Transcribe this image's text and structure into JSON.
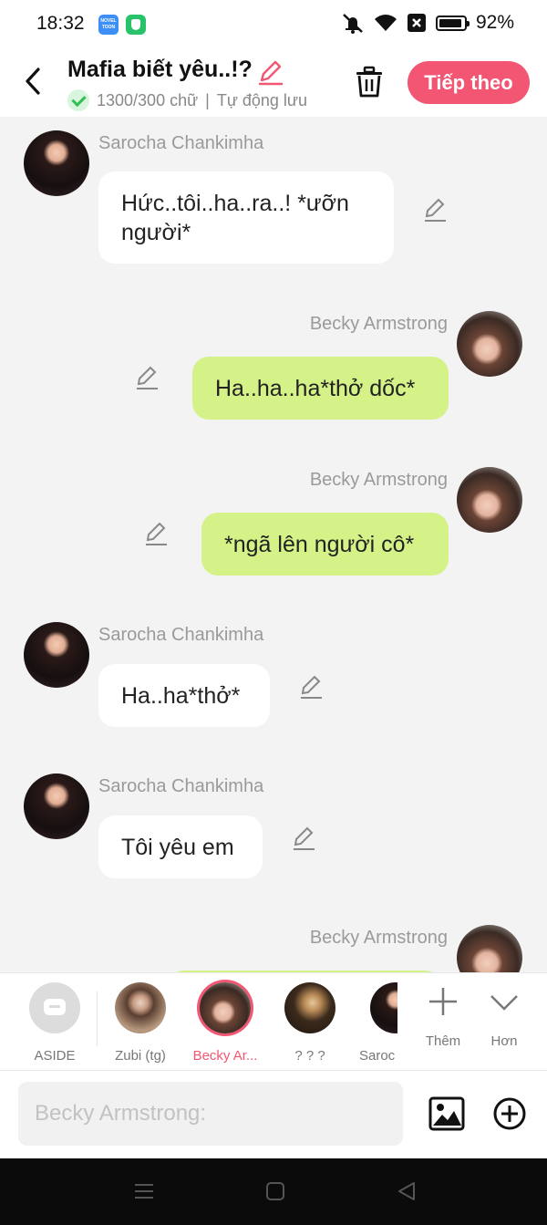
{
  "status_bar": {
    "time": "18:32",
    "app_icon_1_text": "NOVEL TOON",
    "battery": "92%"
  },
  "header": {
    "title": "Mafia biết yêu..!?",
    "word_count": "1300/300 chữ",
    "separator": "|",
    "autosave": "Tự động lưu",
    "next_label": "Tiếp theo",
    "accent_color": "#f25672"
  },
  "messages": [
    {
      "speaker": "Sarocha Chankimha",
      "text": "Hức..tôi..ha..ra..! *ưỡn người*",
      "side": "left"
    },
    {
      "speaker": "Becky Armstrong",
      "text": "Ha..ha..ha*thở dốc*",
      "side": "right"
    },
    {
      "speaker": "Becky Armstrong",
      "text": "*ngã lên người cô*",
      "side": "right"
    },
    {
      "speaker": "Sarocha Chankimha",
      "text": "Ha..ha*thở*",
      "side": "left"
    },
    {
      "speaker": "Sarocha Chankimha",
      "text": "Tôi yêu em",
      "side": "left"
    },
    {
      "speaker": "Becky Armstrong",
      "text": "",
      "side": "right"
    }
  ],
  "characters": [
    {
      "label": "ASIDE"
    },
    {
      "label": "Zubi (tg)"
    },
    {
      "label": "Becky Ar...",
      "selected": true
    },
    {
      "label": "? ? ?"
    },
    {
      "label": "Saroc"
    }
  ],
  "tools": {
    "add_label": "Thêm",
    "more_label": "Hơn"
  },
  "input": {
    "placeholder": "Becky Armstrong:"
  },
  "colors": {
    "my_bubble": "#d5f288",
    "other_bubble": "#ffffff",
    "background": "#f3f3f3"
  }
}
